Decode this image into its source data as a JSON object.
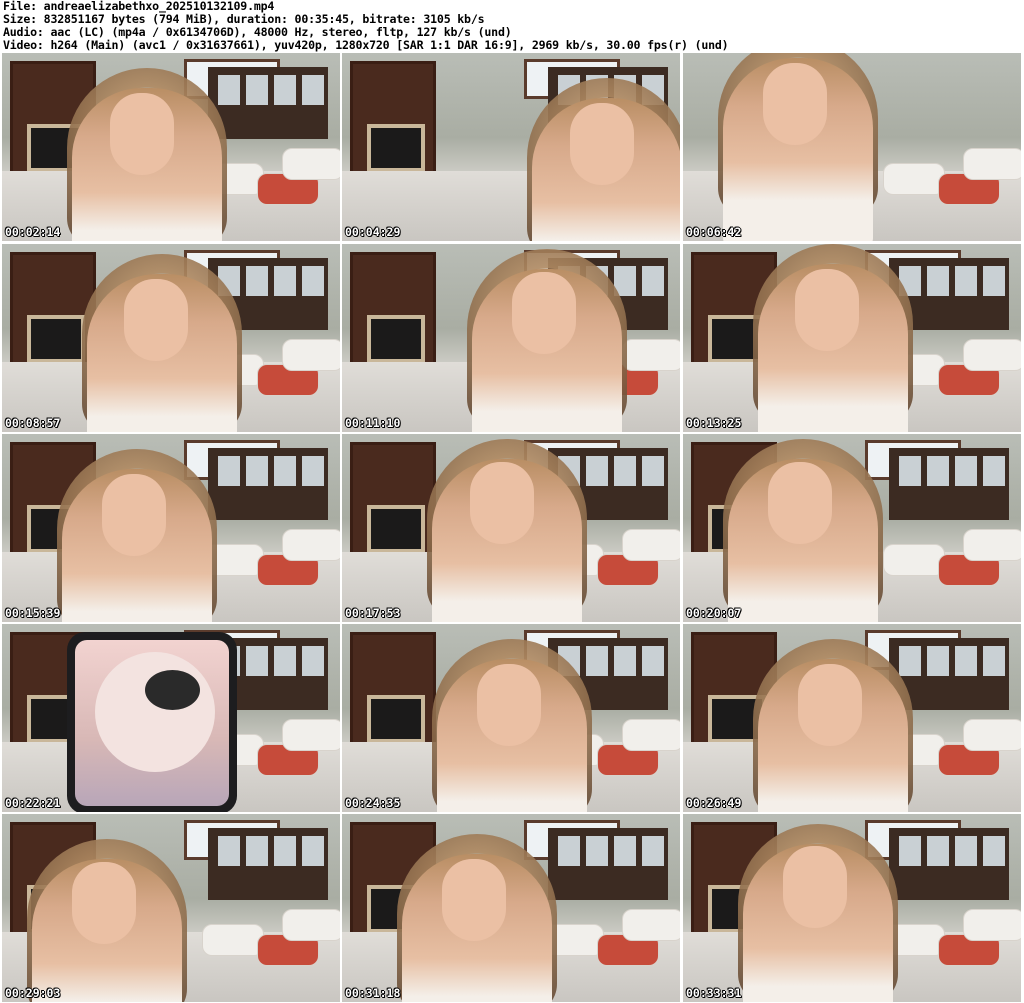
{
  "header": {
    "file": "File: andreaelizabethxo_202510132109.mp4",
    "size": "Size: 832851167 bytes (794 MiB), duration: 00:35:45, bitrate: 3105 kb/s",
    "audio": "Audio: aac (LC) (mp4a / 0x6134706D), 48000 Hz, stereo, fltp, 127 kb/s (und)",
    "video": "Video: h264 (Main) (avc1 / 0x31637661), yuv420p, 1280x720 [SAR 1:1 DAR 16:9], 2969 kb/s, 30.00 fps(r) (und)"
  },
  "thumbnails": [
    {
      "timestamp": "00:02:14"
    },
    {
      "timestamp": "00:04:29"
    },
    {
      "timestamp": "00:06:42"
    },
    {
      "timestamp": "00:08:57"
    },
    {
      "timestamp": "00:11:10"
    },
    {
      "timestamp": "00:13:25"
    },
    {
      "timestamp": "00:15:39"
    },
    {
      "timestamp": "00:17:53"
    },
    {
      "timestamp": "00:20:07"
    },
    {
      "timestamp": "00:22:21"
    },
    {
      "timestamp": "00:24:35"
    },
    {
      "timestamp": "00:26:49"
    },
    {
      "timestamp": "00:29:03"
    },
    {
      "timestamp": "00:31:18"
    },
    {
      "timestamp": "00:33:31"
    }
  ]
}
